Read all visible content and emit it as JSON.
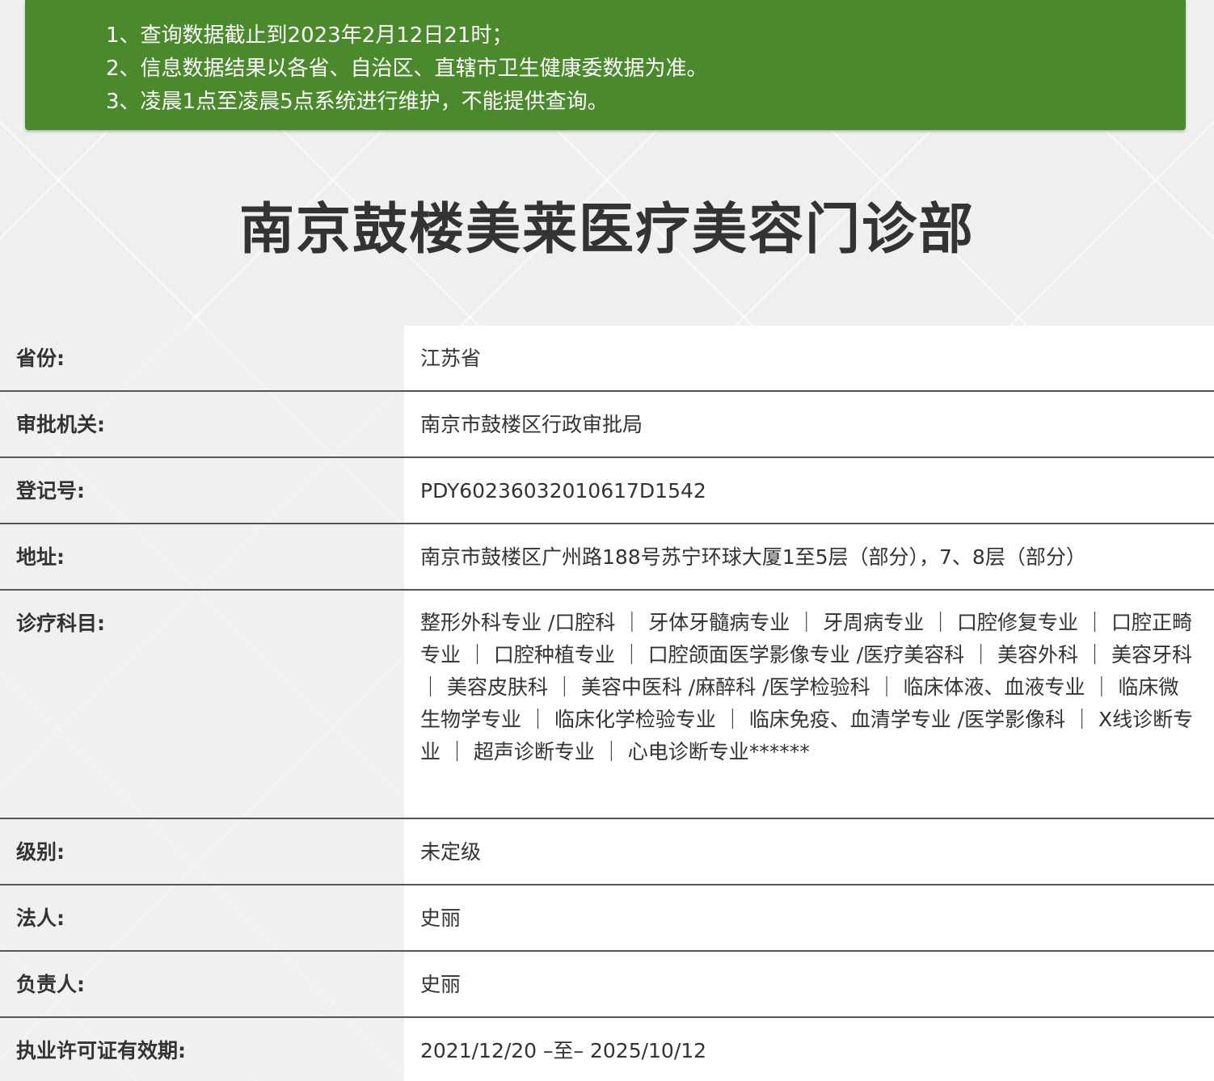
{
  "notice": {
    "lines": [
      "1、查询数据截止到2023年2月12日21时；",
      "2、信息数据结果以各省、自治区、直辖市卫生健康委数据为准。",
      "3、凌晨1点至凌晨5点系统进行维护，不能提供查询。"
    ],
    "background_color": "#4a8a2c"
  },
  "title": "南京鼓楼美莱医疗美容门诊部",
  "fields": {
    "province": {
      "label": "省份:",
      "value": "江苏省"
    },
    "authority": {
      "label": "审批机关:",
      "value": "南京市鼓楼区行政审批局"
    },
    "reg_no": {
      "label": "登记号:",
      "value": "PDY60236032010617D1542"
    },
    "address": {
      "label": "地址:",
      "value": "南京市鼓楼区广州路188号苏宁环球大厦1至5层（部分），7、8层（部分）"
    },
    "departments": {
      "label": "诊疗科目:",
      "value": "整形外科专业 /口腔科 ｜ 牙体牙髓病专业 ｜ 牙周病专业 ｜ 口腔修复专业 ｜ 口腔正畸专业 ｜ 口腔种植专业 ｜ 口腔颌面医学影像专业 /医疗美容科 ｜ 美容外科 ｜ 美容牙科 ｜ 美容皮肤科 ｜ 美容中医科 /麻醉科 /医学检验科 ｜ 临床体液、血液专业 ｜ 临床微生物学专业 ｜ 临床化学检验专业 ｜ 临床免疫、血清学专业 /医学影像科 ｜ X线诊断专业 ｜ 超声诊断专业 ｜ 心电诊断专业******"
    },
    "level": {
      "label": "级别:",
      "value": "未定级"
    },
    "legal_person": {
      "label": "法人:",
      "value": "史丽"
    },
    "person_in_charge": {
      "label": "负责人:",
      "value": "史丽"
    },
    "license_validity": {
      "label": "执业许可证有效期:",
      "value": "2021/12/20 –至– 2025/10/12"
    }
  }
}
